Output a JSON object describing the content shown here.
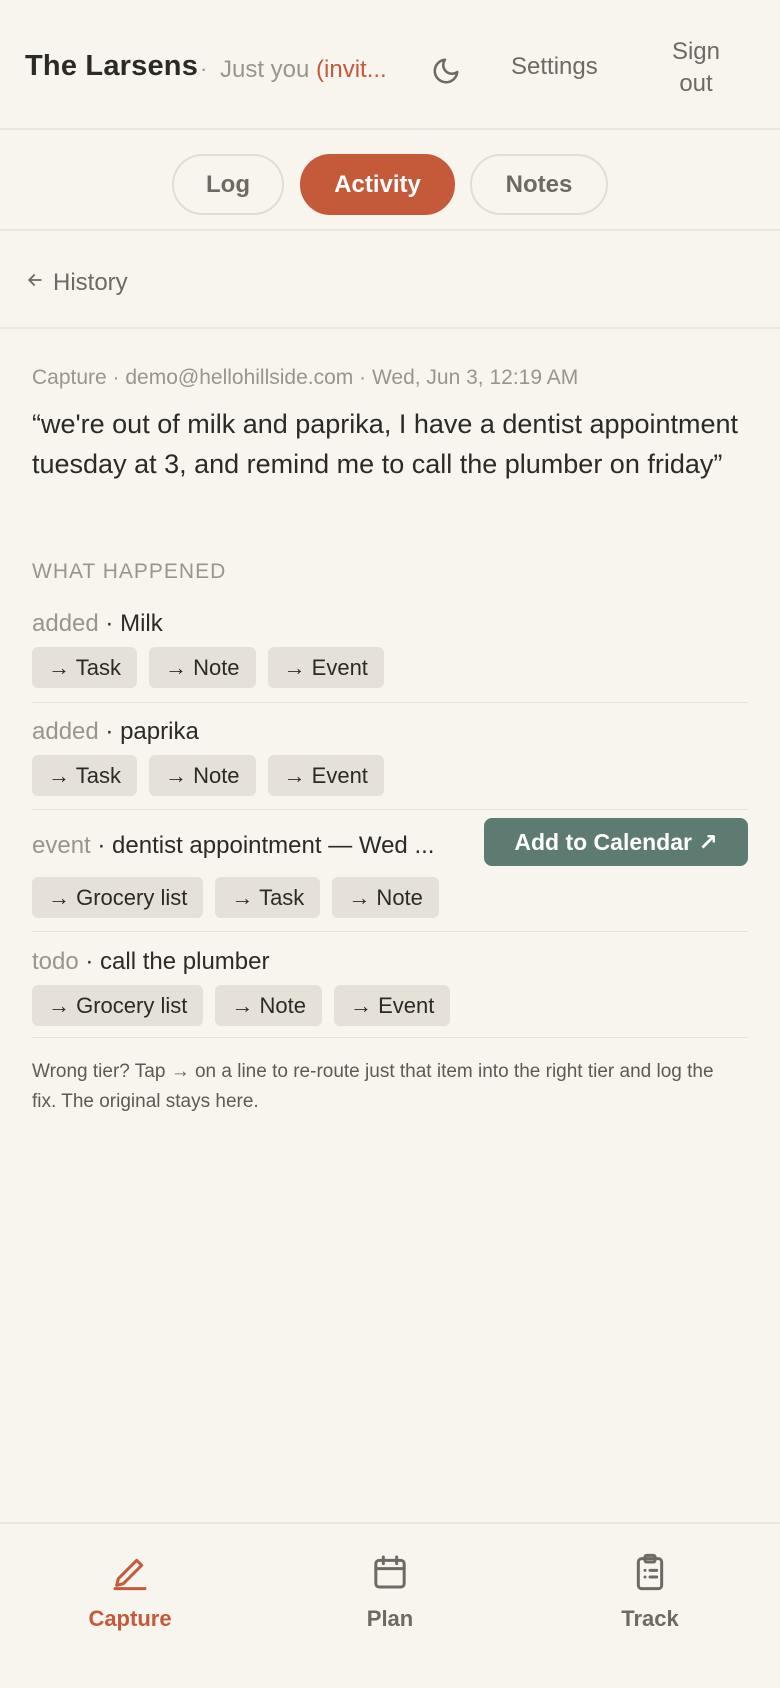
{
  "header": {
    "brand": "The Larsens",
    "separator": "·",
    "who_prefix": "Just you ",
    "who_invite": "(invit...",
    "theme_icon": "moon-icon",
    "settings_label": "Settings",
    "signout_line1": "Sign",
    "signout_line2": "out"
  },
  "tabs": [
    {
      "label": "Log",
      "active": false
    },
    {
      "label": "Activity",
      "active": true
    },
    {
      "label": "Notes",
      "active": false
    }
  ],
  "history": {
    "label": "History",
    "icon": "arrow-left-icon"
  },
  "capture": {
    "meta": "Capture · demo@hellohillside.com · Wed, Jun 3, 12:19 AM",
    "quote": "“we're out of milk and paprika, I have a dentist appointment tuesday at 3, and remind me to call the plumber on friday”",
    "section_label": "WHAT HAPPENED",
    "items": [
      {
        "kind": "added",
        "text": " · Milk",
        "chips": [
          "→ Task",
          "→ Note",
          "→ Event"
        ]
      },
      {
        "kind": "added",
        "text": " · paprika",
        "chips": [
          "→ Task",
          "→ Note",
          "→ Event"
        ]
      },
      {
        "kind": "event",
        "text": " · dentist appointment — Wed ...",
        "chips": [
          "→ Grocery list",
          "→ Task",
          "→ Note"
        ],
        "action": "Add to Calendar ↗"
      },
      {
        "kind": "todo",
        "text": " · call the plumber",
        "chips": [
          "→ Grocery list",
          "→ Note",
          "→ Event"
        ]
      }
    ],
    "footnote": "Wrong tier? Tap → on a line to re-route just that item into the right tier and log the fix. The original stays here."
  },
  "bottom_nav": [
    {
      "label": "Capture",
      "icon": "pen-icon",
      "active": true
    },
    {
      "label": "Plan",
      "icon": "calendar-icon",
      "active": false
    },
    {
      "label": "Track",
      "icon": "clipboard-icon",
      "active": false
    }
  ],
  "colors": {
    "accent": "#c45a3a",
    "calendar_button": "#5d7b70",
    "background": "#f8f5ef",
    "chip": "#e5e1d8"
  }
}
